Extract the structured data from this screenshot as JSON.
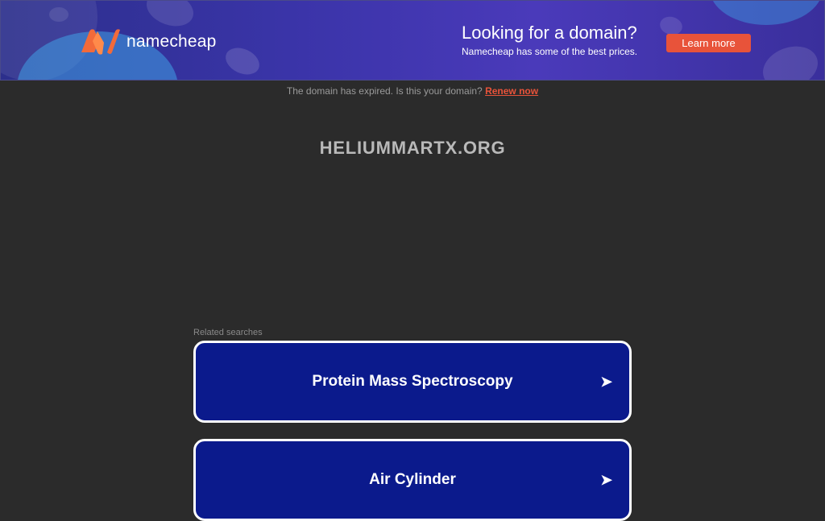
{
  "banner": {
    "brand": "namecheap",
    "title": "Looking for a domain?",
    "subtitle": "Namecheap has some of the best prices.",
    "cta_label": "Learn more",
    "accent_color": "#e8533a"
  },
  "notice": {
    "text": "The domain has expired. Is this your domain?",
    "link_label": "Renew now"
  },
  "domain": {
    "name": "HELIUMMARTX.ORG"
  },
  "related": {
    "heading": "Related searches",
    "items": [
      {
        "label": "Protein Mass Spectroscopy",
        "arrow": "➤"
      },
      {
        "label": "Air Cylinder",
        "arrow": "➤"
      }
    ]
  }
}
